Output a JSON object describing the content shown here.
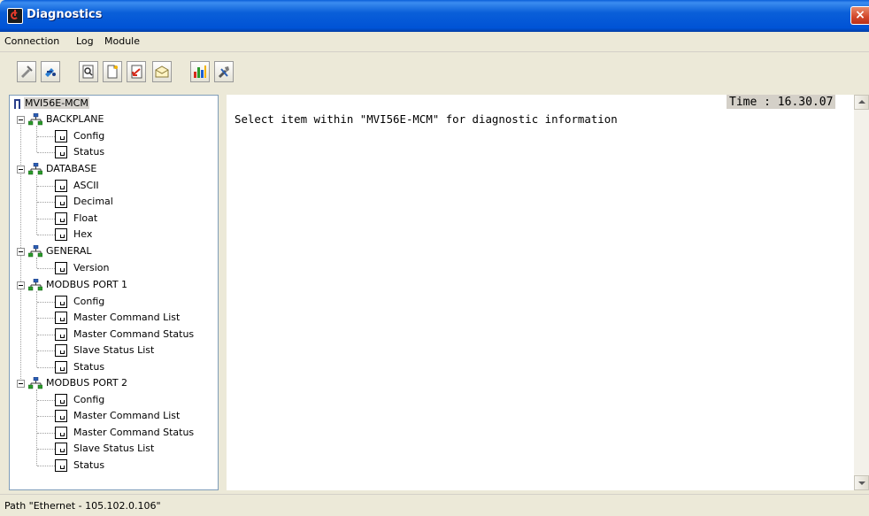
{
  "window": {
    "title": "Diagnostics",
    "close_label": "×"
  },
  "menu": {
    "items": [
      "Connection",
      "Log",
      "Module"
    ]
  },
  "toolbar": {
    "buttons": [
      {
        "icon": "disconnect-icon"
      },
      {
        "icon": "connect-icon"
      },
      {
        "icon": "find-icon"
      },
      {
        "icon": "new-log-icon"
      },
      {
        "icon": "download-icon"
      },
      {
        "icon": "mail-icon"
      },
      {
        "icon": "bar-chart-icon"
      },
      {
        "icon": "tools-icon"
      }
    ]
  },
  "tree": {
    "root": "MVI56E-MCM",
    "groups": [
      {
        "label": "BACKPLANE",
        "children": [
          "Config",
          "Status"
        ]
      },
      {
        "label": "DATABASE",
        "children": [
          "ASCII",
          "Decimal",
          "Float",
          "Hex"
        ]
      },
      {
        "label": "GENERAL",
        "children": [
          "Version"
        ]
      },
      {
        "label": "MODBUS PORT 1",
        "children": [
          "Config",
          "Master Command List",
          "Master Command Status",
          "Slave Status List",
          "Status"
        ]
      },
      {
        "label": "MODBUS PORT 2",
        "children": [
          "Config",
          "Master Command List",
          "Master Command Status",
          "Slave Status List",
          "Status"
        ]
      }
    ]
  },
  "content": {
    "time": "Time : 16.30.07",
    "message": "Select item within \"MVI56E-MCM\" for diagnostic information"
  },
  "status": {
    "path": "Path \"Ethernet - 105.102.0.106\""
  }
}
